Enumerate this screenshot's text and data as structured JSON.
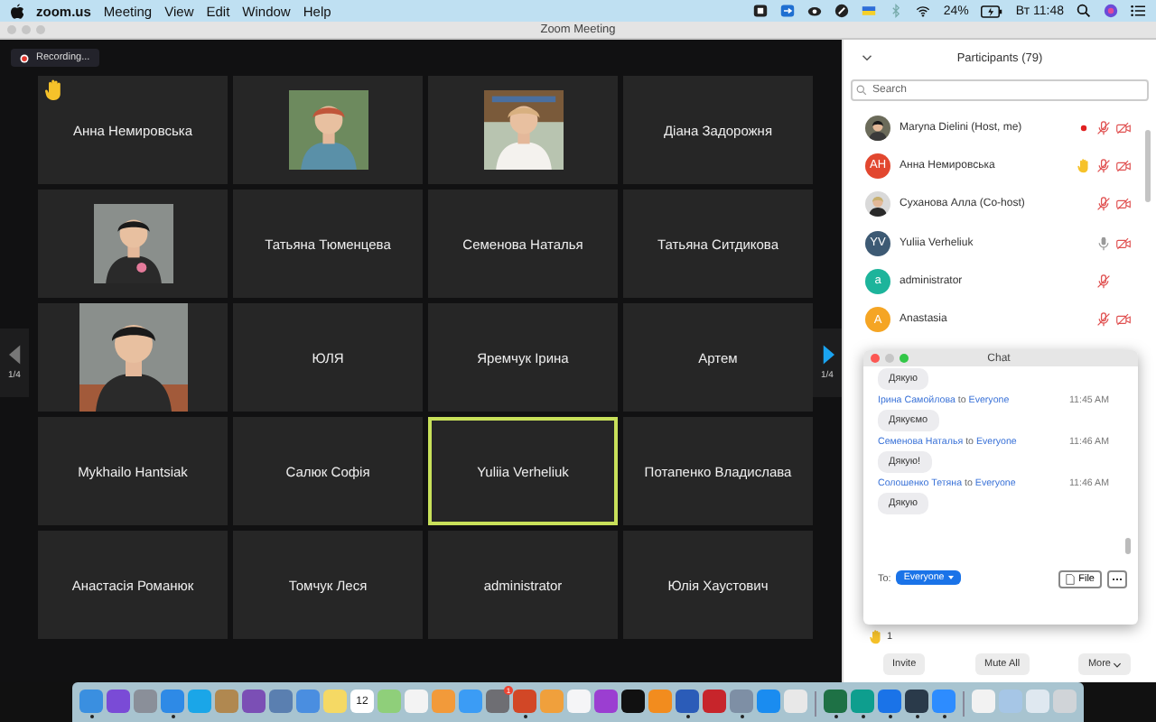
{
  "menubar": {
    "app": "zoom.us",
    "menus": [
      "Meeting",
      "View",
      "Edit",
      "Window",
      "Help"
    ],
    "battery_text": "24%",
    "clock": "Вт 11:48"
  },
  "window": {
    "title": "Zoom Meeting"
  },
  "recording": {
    "label": "Recording..."
  },
  "gallery": {
    "page_left": "1/4",
    "page_right": "1/4",
    "tiles": [
      {
        "kind": "name",
        "name": "Анна Немировська",
        "hand_raised": true,
        "active": false
      },
      {
        "kind": "picture",
        "hand_raised": false,
        "active": false
      },
      {
        "kind": "picture",
        "hand_raised": false,
        "active": false
      },
      {
        "kind": "name",
        "name": "Діана Задорожня",
        "hand_raised": false,
        "active": false
      },
      {
        "kind": "picture",
        "hand_raised": false,
        "active": false
      },
      {
        "kind": "name",
        "name": "Татьяна Тюменцева",
        "hand_raised": false,
        "active": false
      },
      {
        "kind": "name",
        "name": "Семенова Наталья",
        "hand_raised": false,
        "active": false
      },
      {
        "kind": "name",
        "name": "Татьяна Ситдикова",
        "hand_raised": false,
        "active": false
      },
      {
        "kind": "picture",
        "hand_raised": false,
        "active": false
      },
      {
        "kind": "name",
        "name": "ЮЛЯ",
        "hand_raised": false,
        "active": false
      },
      {
        "kind": "name",
        "name": "Яремчук Ірина",
        "hand_raised": false,
        "active": false
      },
      {
        "kind": "name",
        "name": "Артем",
        "hand_raised": false,
        "active": false
      },
      {
        "kind": "name",
        "name": "Mykhailo Hantsiak",
        "hand_raised": false,
        "active": false
      },
      {
        "kind": "name",
        "name": "Салюк Софія",
        "hand_raised": false,
        "active": false
      },
      {
        "kind": "name",
        "name": "Yuliia Verheliuk",
        "hand_raised": false,
        "active": true
      },
      {
        "kind": "name",
        "name": "Потапенко Владислава",
        "hand_raised": false,
        "active": false
      },
      {
        "kind": "name",
        "name": "Анастасія Романюк",
        "hand_raised": false,
        "active": false
      },
      {
        "kind": "name",
        "name": "Томчук Леся",
        "hand_raised": false,
        "active": false
      },
      {
        "kind": "name",
        "name": "administrator",
        "hand_raised": false,
        "active": false
      },
      {
        "kind": "name",
        "name": "Юлія Хаустович",
        "hand_raised": false,
        "active": false
      }
    ]
  },
  "participants": {
    "title": "Participants (79)",
    "search": {
      "placeholder": "Search"
    },
    "rows": [
      {
        "name": "Maryna Dielini (Host, me)",
        "avatar": {
          "kind": "picture"
        },
        "recording": true,
        "hand_raised": false,
        "mic_muted": true,
        "video_off": true
      },
      {
        "name": "Анна Немировська",
        "avatar": {
          "kind": "initials",
          "text": "AH",
          "color": "#e2472f"
        },
        "recording": false,
        "hand_raised": true,
        "mic_muted": true,
        "video_off": true
      },
      {
        "name": "Суханова Алла (Co-host)",
        "avatar": {
          "kind": "picture"
        },
        "recording": false,
        "hand_raised": false,
        "mic_muted": true,
        "video_off": true
      },
      {
        "name": "Yuliia Verheliuk",
        "avatar": {
          "kind": "initials",
          "text": "YV",
          "color": "#3d5a74"
        },
        "recording": false,
        "hand_raised": false,
        "mic_muted": false,
        "video_off": true
      },
      {
        "name": "administrator",
        "avatar": {
          "kind": "initials",
          "text": "a",
          "color": "#1db49b"
        },
        "recording": false,
        "hand_raised": false,
        "mic_muted": true,
        "video_off": false
      },
      {
        "name": "Anastasia",
        "avatar": {
          "kind": "initials",
          "text": "A",
          "color": "#f5a524"
        },
        "recording": false,
        "hand_raised": false,
        "mic_muted": true,
        "video_off": true
      }
    ],
    "reaction_count": "1",
    "buttons": [
      "Invite",
      "Mute All",
      "More"
    ]
  },
  "chat": {
    "title": "Chat",
    "messages": [
      {
        "text": "Дякую"
      },
      {
        "sender": "Ірина Самойлова",
        "joiner": "to",
        "recipient": "Everyone",
        "time": "11:45 AM",
        "text": "Дякуємо"
      },
      {
        "sender": "Семенова Наталья",
        "joiner": "to",
        "recipient": "Everyone",
        "time": "11:46 AM",
        "text": "Дякую!"
      },
      {
        "sender": "Солошенко Тетяна",
        "joiner": "to",
        "recipient": "Everyone",
        "time": "11:46 AM",
        "text": "Дякую"
      }
    ],
    "to_label": "To:",
    "recipient": "Everyone",
    "file_button": "File"
  },
  "dock": [
    {
      "kind": "app",
      "color": "#3a8fe0",
      "running": true
    },
    {
      "kind": "app",
      "color": "#7a4bd6",
      "running": false
    },
    {
      "kind": "app",
      "color": "#8a8f99",
      "running": false
    },
    {
      "kind": "app",
      "color": "#2e8ae6",
      "running": true
    },
    {
      "kind": "app",
      "color": "#1aa6e8",
      "running": false
    },
    {
      "kind": "app",
      "color": "#b08850",
      "running": false
    },
    {
      "kind": "app",
      "color": "#7b4fb5",
      "running": false
    },
    {
      "kind": "app",
      "color": "#5a7fb0",
      "running": false
    },
    {
      "kind": "app",
      "color": "#4a8ee0",
      "running": false
    },
    {
      "kind": "app",
      "color": "#f5d964",
      "running": false
    },
    {
      "kind": "app",
      "color": "#ffffff",
      "label": "12",
      "running": false
    },
    {
      "kind": "app",
      "color": "#8fcf7a",
      "running": false
    },
    {
      "kind": "app",
      "color": "#f3f3f3",
      "running": false
    },
    {
      "kind": "app",
      "color": "#f29a3a",
      "running": false
    },
    {
      "kind": "app",
      "color": "#3b9cf5",
      "running": false
    },
    {
      "kind": "app",
      "color": "#6e6e73",
      "badge": "1",
      "running": false
    },
    {
      "kind": "app",
      "color": "#d24726",
      "running": true
    },
    {
      "kind": "app",
      "color": "#f0a03c",
      "running": false
    },
    {
      "kind": "app",
      "color": "#f5f5f7",
      "running": false
    },
    {
      "kind": "app",
      "color": "#9b3ed1",
      "running": false
    },
    {
      "kind": "app",
      "color": "#111111",
      "running": false
    },
    {
      "kind": "app",
      "color": "#f28c1e",
      "running": false
    },
    {
      "kind": "app",
      "color": "#2b5cb8",
      "running": true
    },
    {
      "kind": "app",
      "color": "#c7252b",
      "running": false
    },
    {
      "kind": "app",
      "color": "#7e8fa5",
      "running": true
    },
    {
      "kind": "app",
      "color": "#1a8cf0",
      "running": false
    },
    {
      "kind": "app",
      "color": "#e8e8e8",
      "running": false
    },
    {
      "kind": "separator"
    },
    {
      "kind": "app",
      "color": "#1e7145",
      "running": true
    },
    {
      "kind": "app",
      "color": "#0e9e8e",
      "running": true
    },
    {
      "kind": "app",
      "color": "#1a73e8",
      "running": true
    },
    {
      "kind": "app",
      "color": "#2a3a4a",
      "running": true
    },
    {
      "kind": "app",
      "color": "#2d8cff",
      "running": true
    },
    {
      "kind": "separator"
    },
    {
      "kind": "app",
      "color": "#f2f2f2",
      "running": false
    },
    {
      "kind": "app",
      "color": "#a6c6e6",
      "running": false
    },
    {
      "kind": "app",
      "color": "#dfe8f0",
      "running": false
    },
    {
      "kind": "app",
      "color": "#d0d4d8",
      "running": false
    }
  ]
}
